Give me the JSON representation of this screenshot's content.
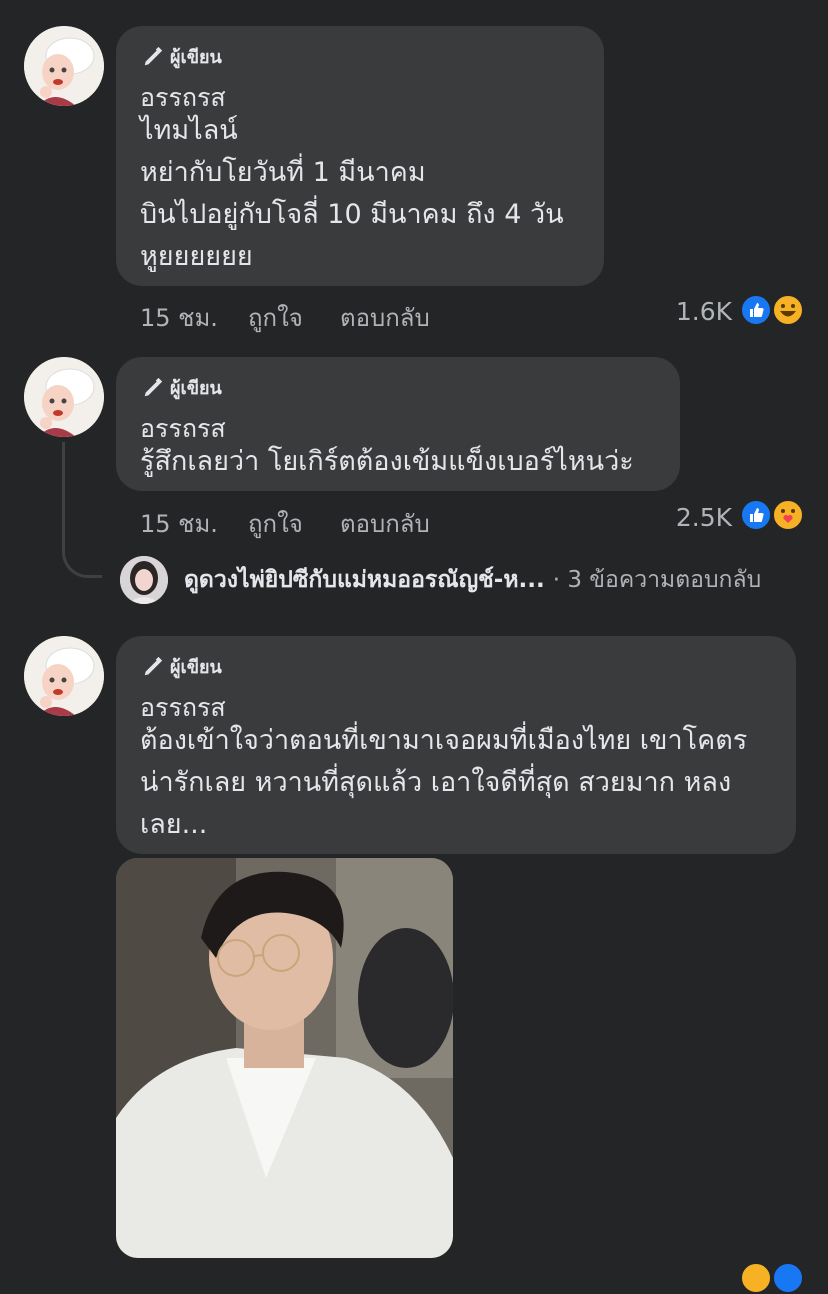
{
  "comments": [
    {
      "badge": "ผู้เขียน",
      "author": "อรรถรส",
      "text": "ไทมไลน์\nหย่ากับโยวันที่ 1 มีนาคม\nบินไปอยู่กับโจลี่ 10 มีนาคม ถึง 4 วัน\nหูยยยยยย",
      "time": "15 ชม.",
      "like": "ถูกใจ",
      "reply": "ตอบกลับ",
      "reaction_count": "1.6K",
      "reactions": [
        "like-icon",
        "haha-icon"
      ]
    },
    {
      "badge": "ผู้เขียน",
      "author": "อรรถรส",
      "text": "รู้สึกเลยว่า โยเกิร์ตต้องเข้มแข็งเบอร์ไหนว่ะ",
      "time": "15 ชม.",
      "like": "ถูกใจ",
      "reply": "ตอบกลับ",
      "reaction_count": "2.5K",
      "reactions": [
        "like-icon",
        "care-icon"
      ]
    },
    {
      "badge": "ผู้เขียน",
      "author": "อรรถรส",
      "text": "ต้องเข้าใจว่าตอนที่เขามาเจอผมที่เมืองไทย เขาโคตรน่ารักเลย หวานที่สุดแล้ว เอาใจดีที่สุด สวยมาก หลงเลย..."
    }
  ],
  "reply_summary": {
    "name": "ดูดวงไพ่ยิปซีกับแม่หมออรณัญช์-ห...",
    "count": "· 3 ข้อความตอบกลับ"
  },
  "colors": {
    "background": "#242526",
    "bubble": "#3a3b3c",
    "like": "#1877f2",
    "haha": "#f7b125"
  }
}
